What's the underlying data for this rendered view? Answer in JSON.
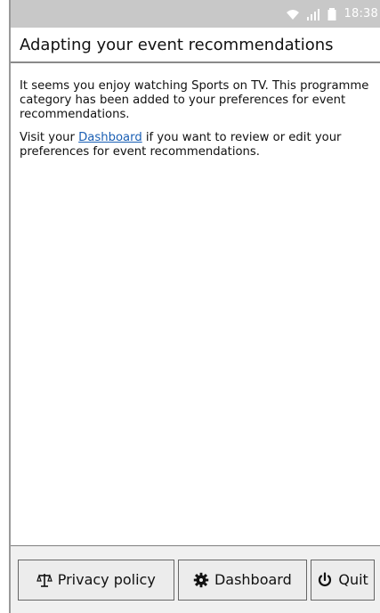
{
  "status_bar": {
    "time": "18:38",
    "icons": [
      "wifi-icon",
      "signal-icon",
      "battery-icon"
    ]
  },
  "header": {
    "title": "Adapting your event recommendations"
  },
  "content": {
    "paragraph1": "It seems you enjoy watching Sports on TV. This programme category has been added to your preferences for event recommendations.",
    "paragraph2_before": "Visit your ",
    "paragraph2_link": "Dashboard",
    "paragraph2_after": " if you want to review or edit your preferences for event recommendations."
  },
  "bottom_bar": {
    "privacy_label": "Privacy policy",
    "dashboard_label": "Dashboard",
    "quit_label": "Quit",
    "icons": {
      "privacy": "scales-icon",
      "dashboard": "gear-icon",
      "quit": "power-icon"
    }
  },
  "colors": {
    "status_bar": "#c8c8c8",
    "link": "#1a5fb4",
    "button_bg": "#ececec"
  }
}
